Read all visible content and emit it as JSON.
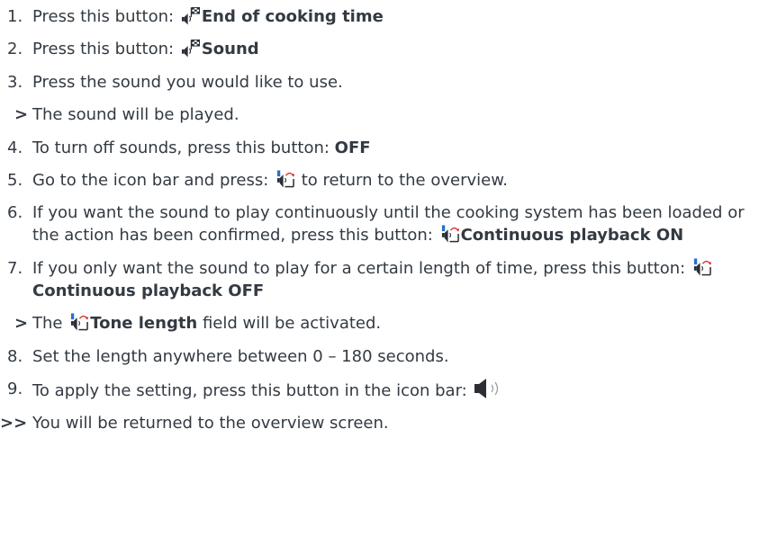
{
  "steps": [
    {
      "marker": "1.",
      "type": "numbered",
      "pre": "Press this button: ",
      "icon": "flag-speaker-icon",
      "bold": "End of cooking time",
      "post": ""
    },
    {
      "marker": "2.",
      "type": "numbered",
      "pre": "Press this button: ",
      "icon": "flag-speaker-icon",
      "bold": "Sound",
      "post": ""
    },
    {
      "marker": "3.",
      "type": "numbered",
      "pre": "Press the sound you would like to use.",
      "bold": "",
      "post": ""
    },
    {
      "marker": ">",
      "type": "result",
      "pre": "The sound will be played.",
      "bold": "",
      "post": ""
    },
    {
      "marker": "4.",
      "type": "numbered",
      "pre": "To turn off sounds, press this button: ",
      "bold": "OFF",
      "post": ""
    },
    {
      "marker": "5.",
      "type": "numbered",
      "pre": "Go to the icon bar and press: ",
      "icon": "speaker-loop-icon",
      "bold": "",
      "post": " to return to the overview."
    },
    {
      "marker": "6.",
      "type": "numbered",
      "pre": "If you want the sound to play continuously until the cooking system has been loaded or the action has been confirmed, press this button: ",
      "icon": "speaker-loop-icon",
      "bold": "Continuous playback ON",
      "post": ""
    },
    {
      "marker": "7.",
      "type": "numbered",
      "pre": "If you only want the sound to play for a certain length of time, press this button: ",
      "icon": "speaker-loop-icon",
      "bold": "Continuous playback OFF",
      "post": ""
    },
    {
      "marker": ">",
      "type": "result",
      "pre": "The ",
      "icon": "speaker-loop-icon",
      "bold": "Tone length",
      "post": " field will be activated."
    },
    {
      "marker": "8.",
      "type": "numbered",
      "pre": "Set the length anywhere between 0 – 180 seconds.",
      "bold": "",
      "post": ""
    },
    {
      "marker": "9.",
      "type": "numbered",
      "pre": "To apply the setting, press this button in the icon bar: ",
      "icon": "speaker-volume-icon",
      "bold": "",
      "post": ""
    },
    {
      "marker": ">>",
      "type": "final",
      "pre": "You will be returned to the overview screen.",
      "bold": "",
      "post": ""
    }
  ],
  "colors": {
    "text": "#333a42",
    "icon_dark": "#2b2f35",
    "icon_blue": "#2a6fc9",
    "icon_red": "#d9322b",
    "icon_grey": "#9aa0a6"
  }
}
